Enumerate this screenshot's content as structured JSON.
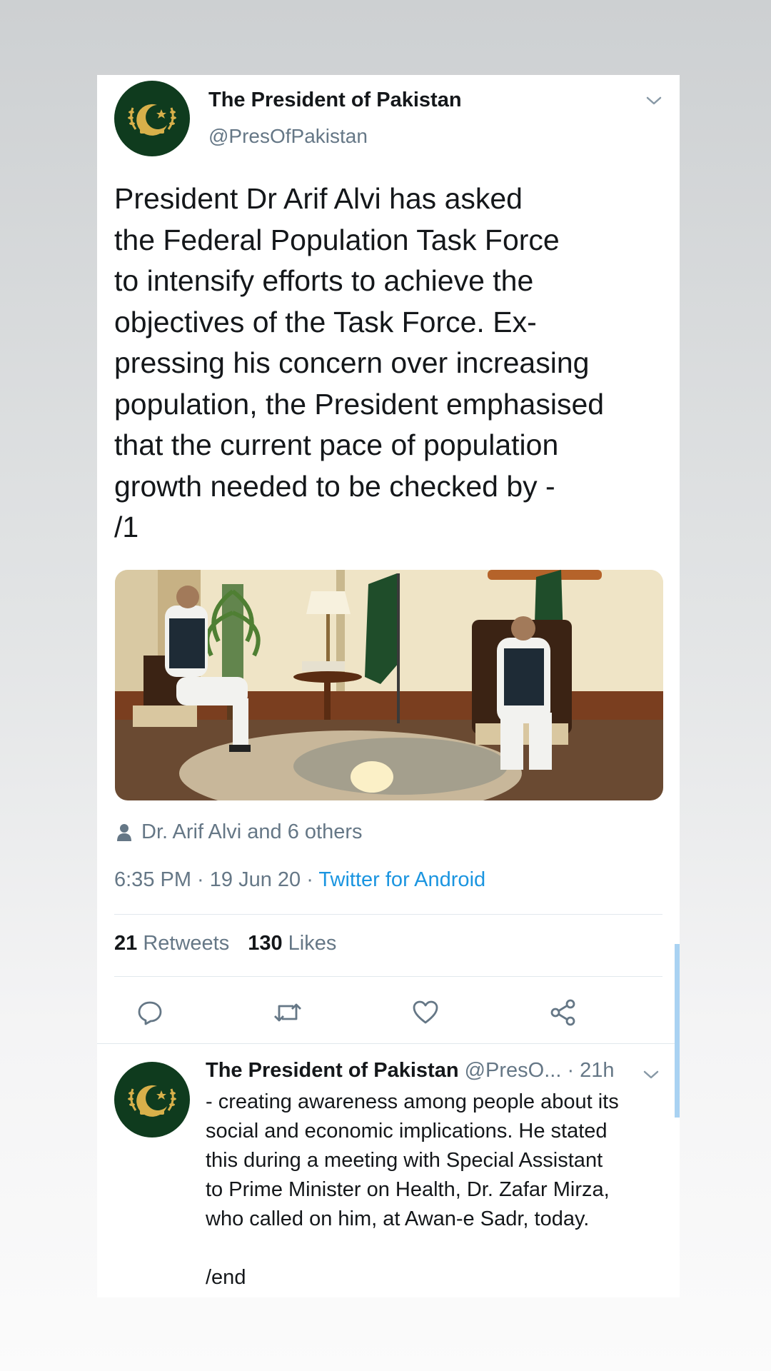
{
  "tweet": {
    "author_name": "The President of Pakistan",
    "author_handle": "@PresOfPakistan",
    "text": "President Dr Arif Alvi has asked\nthe Federal Population Task Force\nto intensify efforts to achieve the\nobjectives of the Task Force. Ex-\npressing his concern over increasing\npopulation, the President emphasised\nthat the current pace of population\ngrowth needed to be checked by -\n/1",
    "liked_by": "Dr. Arif Alvi and 6 others",
    "time": "6:35 PM",
    "date": "19 Jun 20",
    "source": "Twitter for Android",
    "retweets_count": "21",
    "retweets_label": "Retweets",
    "likes_count": "130",
    "likes_label": "Likes"
  },
  "reply": {
    "author_name": "The President of Pakistan",
    "meta": "@PresO... · 21h",
    "text": "- creating awareness among people about its\nsocial and economic implications. He stated\nthis during a meeting with Special Assistant\nto Prime Minister on Health, Dr. Zafar Mirza,\nwho called on him, at Awan-e Sadr, today.\n\n/end"
  },
  "icons": {
    "caret": "chevron-down-icon",
    "person": "person-icon",
    "reply": "reply-icon",
    "retweet": "retweet-icon",
    "like": "heart-icon",
    "share": "share-icon"
  },
  "colors": {
    "link": "#1b95e0",
    "secondary_text": "#657786",
    "primary_text": "#14171a",
    "avatar_bg": "#0f3b1e",
    "emblem_gold": "#d8b04a",
    "scrollbar": "#a9d2f2"
  }
}
